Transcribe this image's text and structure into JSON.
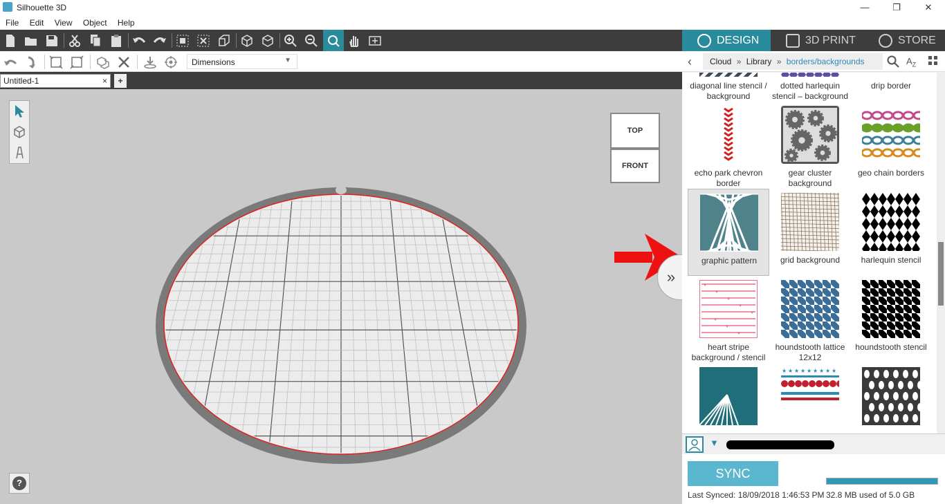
{
  "window": {
    "title": "Silhouette 3D",
    "minimize": "—",
    "maximize": "❐",
    "close": "✕"
  },
  "menu": [
    "File",
    "Edit",
    "View",
    "Object",
    "Help"
  ],
  "toolbar2": {
    "dimensions_label": "Dimensions"
  },
  "document_tab": {
    "label": "Untitled-1",
    "close": "×",
    "add": "+"
  },
  "viewcube": {
    "top": "TOP",
    "front": "FRONT"
  },
  "panel_tabs": [
    {
      "label": "DESIGN",
      "active": true
    },
    {
      "label": "3D PRINT",
      "active": false
    },
    {
      "label": "STORE",
      "active": false
    }
  ],
  "breadcrumb": {
    "items": [
      "Cloud",
      "Library"
    ],
    "current": "borders/backgrounds",
    "separator": "»"
  },
  "library": {
    "items": [
      {
        "label": "diagonal line stencil / background",
        "icon": "diagonal-lines"
      },
      {
        "label": "dotted harlequin stencil – background",
        "icon": "dotted-harlequin"
      },
      {
        "label": "drip border",
        "icon": "drip-border"
      },
      {
        "label": "echo park chevron border",
        "icon": "chevron-border"
      },
      {
        "label": "gear cluster background",
        "icon": "gear-cluster"
      },
      {
        "label": "geo chain borders",
        "icon": "geo-chain"
      },
      {
        "label": "graphic pattern",
        "icon": "graphic-pattern",
        "selected": true
      },
      {
        "label": "grid background",
        "icon": "grid-background"
      },
      {
        "label": "harlequin stencil",
        "icon": "harlequin"
      },
      {
        "label": "heart stripe background / stencil",
        "icon": "heart-stripe"
      },
      {
        "label": "houndstooth lattice 12x12",
        "icon": "houndstooth-lattice"
      },
      {
        "label": "houndstooth stencil",
        "icon": "houndstooth"
      },
      {
        "label": "",
        "icon": "sunburst-corner"
      },
      {
        "label": "",
        "icon": "scallop-border"
      },
      {
        "label": "",
        "icon": "raindrop"
      }
    ]
  },
  "sync": {
    "button": "SYNC",
    "last_synced": "Last Synced: 18/09/2018 1:46:53 PM",
    "storage": "32.8 MB used of 5.0 GB",
    "storage_fraction": 0.0066
  },
  "colors": {
    "accent": "#2a8b9c",
    "sync": "#5bb7cf",
    "breadcrumb_link": "#2a8bb9",
    "bed_outline": "#e02020",
    "arrow": "#ee1111"
  }
}
